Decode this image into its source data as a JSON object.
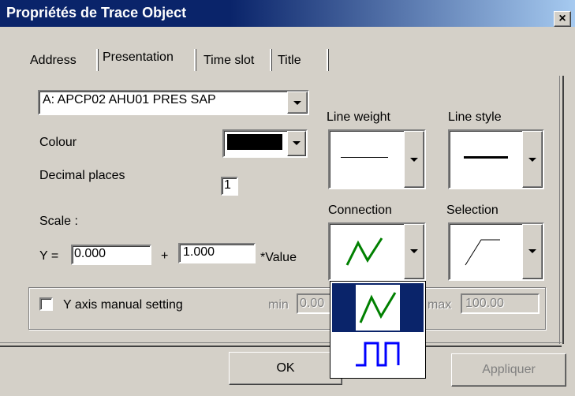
{
  "window": {
    "title": "Propriétés de Trace Object",
    "close_label": "×"
  },
  "tabs": [
    {
      "label": "Address",
      "active": false
    },
    {
      "label": "Presentation",
      "active": true
    },
    {
      "label": "Time slot",
      "active": false
    },
    {
      "label": "Title",
      "active": false
    }
  ],
  "presentation": {
    "trace_select": "A:  APCP02 AHU01 PRES SAP",
    "colour_label": "Colour",
    "colour_value": "#000000",
    "decimal_label": "Decimal places",
    "decimal_value": "1",
    "scale_label": "Scale :",
    "y_eq_label": "Y =",
    "offset_value": "0.000",
    "plus_label": "+",
    "factor_value": "1.000",
    "value_suffix": "*Value",
    "line_weight_label": "Line weight",
    "line_style_label": "Line style",
    "connection_label": "Connection",
    "selection_label": "Selection"
  },
  "y_axis": {
    "checkbox_label": "Y axis manual setting",
    "checked": false,
    "min_label": "min",
    "min_value": "0.00",
    "max_label": "max",
    "max_value": "100.00"
  },
  "connection_popup": {
    "options": [
      "connection-line-icon",
      "connection-step-icon"
    ],
    "highlighted_index": 0,
    "highlight_color": "#0a246a"
  },
  "buttons": {
    "ok": "OK",
    "apply": "Appliquer"
  }
}
